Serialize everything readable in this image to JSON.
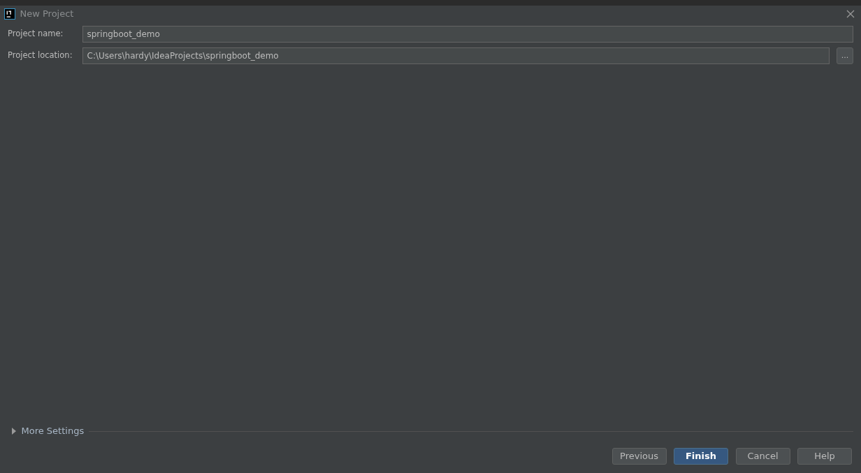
{
  "window": {
    "title": "New Project"
  },
  "fields": [
    {
      "label": "Project name:",
      "value": "springboot_demo",
      "browse": false
    },
    {
      "label": "Project location:",
      "value": "C:\\Users\\hardy\\IdeaProjects\\springboot_demo",
      "browse": true,
      "browse_label": "..."
    }
  ],
  "more_settings": {
    "label": "More Settings",
    "expanded": false
  },
  "buttons": [
    {
      "label": "Previous",
      "default": false
    },
    {
      "label": "Finish",
      "default": true
    },
    {
      "label": "Cancel",
      "default": false
    },
    {
      "label": "Help",
      "default": false
    }
  ]
}
